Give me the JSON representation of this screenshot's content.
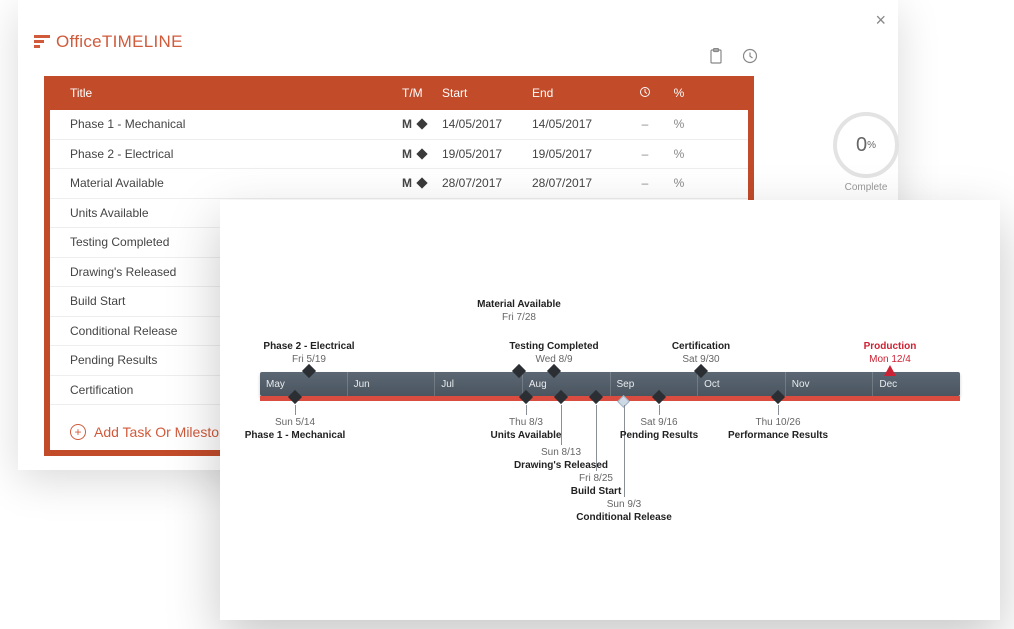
{
  "app": {
    "brand_prefix": "Office",
    "brand_suffix": "TIMELINE",
    "add_link": "Add Task Or Milestone"
  },
  "progress": {
    "value": "0",
    "unit": "%",
    "label": "Complete"
  },
  "table": {
    "headers": {
      "title": "Title",
      "tm": "T/M",
      "start": "Start",
      "end": "End",
      "pct": "%"
    },
    "rows": [
      {
        "title": "Phase 1 - Mechanical",
        "tm": "M",
        "start": "14/05/2017",
        "end": "14/05/2017",
        "dur": "–",
        "pct": "%"
      },
      {
        "title": "Phase 2 - Electrical",
        "tm": "M",
        "start": "19/05/2017",
        "end": "19/05/2017",
        "dur": "–",
        "pct": "%"
      },
      {
        "title": "Material Available",
        "tm": "M",
        "start": "28/07/2017",
        "end": "28/07/2017",
        "dur": "–",
        "pct": "%"
      },
      {
        "title": "Units Available",
        "tm": "",
        "start": "",
        "end": "",
        "dur": "",
        "pct": ""
      },
      {
        "title": "Testing Completed",
        "tm": "",
        "start": "",
        "end": "",
        "dur": "",
        "pct": ""
      },
      {
        "title": "Drawing's Released",
        "tm": "",
        "start": "",
        "end": "",
        "dur": "",
        "pct": ""
      },
      {
        "title": "Build Start",
        "tm": "",
        "start": "",
        "end": "",
        "dur": "",
        "pct": ""
      },
      {
        "title": "Conditional Release",
        "tm": "",
        "start": "",
        "end": "",
        "dur": "",
        "pct": ""
      },
      {
        "title": "Pending Results",
        "tm": "",
        "start": "",
        "end": "",
        "dur": "",
        "pct": ""
      },
      {
        "title": "Certification",
        "tm": "",
        "start": "",
        "end": "",
        "dur": "",
        "pct": ""
      }
    ]
  },
  "timeline": {
    "months": [
      "May",
      "Jun",
      "Jul",
      "Aug",
      "Sep",
      "Oct",
      "Nov",
      "Dec"
    ],
    "milestones_above": [
      {
        "title": "Phase 2 - Electrical",
        "date": "Fri 5/19",
        "pct": 7
      },
      {
        "title": "Material Available",
        "date": "Fri 7/28",
        "pct": 37,
        "shift": -42
      },
      {
        "title": "Testing Completed",
        "date": "Wed 8/9",
        "pct": 42
      },
      {
        "title": "Certification",
        "date": "Sat 9/30",
        "pct": 63
      },
      {
        "title": "Production",
        "date": "Mon 12/4",
        "pct": 90,
        "red": true
      }
    ],
    "milestones_below": [
      {
        "title": "Phase 1 - Mechanical",
        "date": "Sun 5/14",
        "pct": 5,
        "stick": 10
      },
      {
        "title": "Units Available",
        "date": "Thu 8/3",
        "pct": 38,
        "stick": 10
      },
      {
        "title": "Drawing's Released",
        "date": "Sun 8/13",
        "pct": 43,
        "stick": 40
      },
      {
        "title": "Build Start",
        "date": "Fri 8/25",
        "pct": 48,
        "stick": 66
      },
      {
        "title": "Conditional Release",
        "date": "Sun 9/3",
        "pct": 52,
        "stick": 92,
        "light": true
      },
      {
        "title": "Pending Results",
        "date": "Sat 9/16",
        "pct": 57,
        "stick": 10
      },
      {
        "title": "Performance Results",
        "date": "Thu 10/26",
        "pct": 74,
        "stick": 10
      }
    ]
  }
}
